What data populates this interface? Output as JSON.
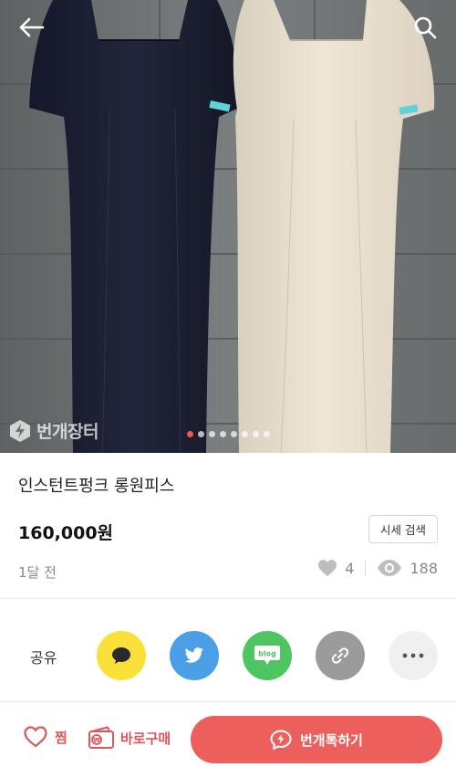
{
  "header": {
    "back_icon": "arrow-left-icon",
    "search_icon": "search-icon",
    "watermark": "번개장터",
    "image_count": 8,
    "active_image": 0
  },
  "product": {
    "title": "인스턴트펑크 롱원피스",
    "price": "160,000원",
    "price_search_button": "시세 검색",
    "posted": "1달 전",
    "likes": "4",
    "views": "188"
  },
  "share": {
    "label": "공유",
    "items": [
      {
        "name": "kakaotalk",
        "icon": "speech-bubble-icon",
        "color": "#f9e13a"
      },
      {
        "name": "twitter",
        "icon": "twitter-bird-icon",
        "color": "#4a9fe6"
      },
      {
        "name": "blog",
        "icon": "blog-icon",
        "label": "blog",
        "color": "#4dc661"
      },
      {
        "name": "link",
        "icon": "link-icon",
        "color": "#9b9b9b"
      },
      {
        "name": "more",
        "icon": "more-dots-icon",
        "color": "#f0f0f0"
      }
    ]
  },
  "bottom_bar": {
    "like_label": "찜",
    "buy_label": "바로구매",
    "talk_label": "번개톡하기",
    "accent": "#ec5f5d"
  }
}
